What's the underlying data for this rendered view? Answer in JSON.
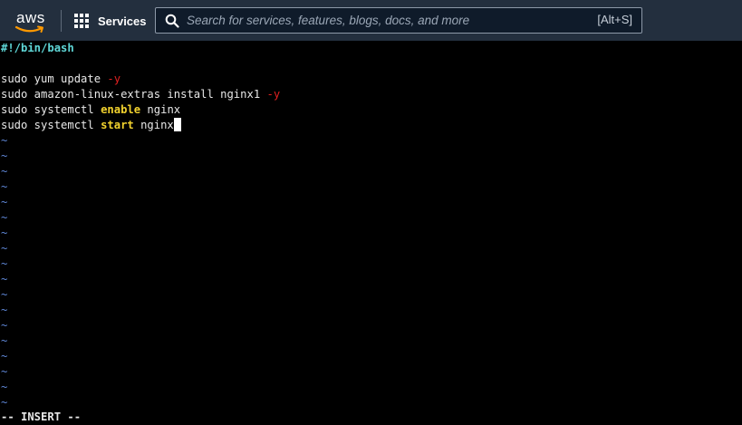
{
  "header": {
    "logo_text": "aws",
    "services_label": "Services",
    "search_placeholder": "Search for services, features, blogs, docs, and more",
    "search_shortcut": "[Alt+S]",
    "colors": {
      "bar_bg": "#232f3e",
      "search_bg": "#0f1b2a",
      "logo_smile": "#ff9900"
    }
  },
  "editor": {
    "shebang": "#!/bin/bash",
    "line1": {
      "cmd": "sudo yum update ",
      "flag": "-y"
    },
    "line2": {
      "cmd": "sudo amazon-linux-extras install nginx1 ",
      "flag": "-y"
    },
    "line3": {
      "pre": "sudo systemctl ",
      "kw": "enable",
      "post": " nginx"
    },
    "line4": {
      "pre": "sudo systemctl ",
      "kw": "start",
      "post": " nginx"
    },
    "tilde": "~",
    "mode_text": "-- INSERT --",
    "colors": {
      "shebang": "#5fd7d7",
      "flag": "#e02020",
      "keyword": "#f2d22e",
      "tilde": "#5f87d7"
    }
  }
}
